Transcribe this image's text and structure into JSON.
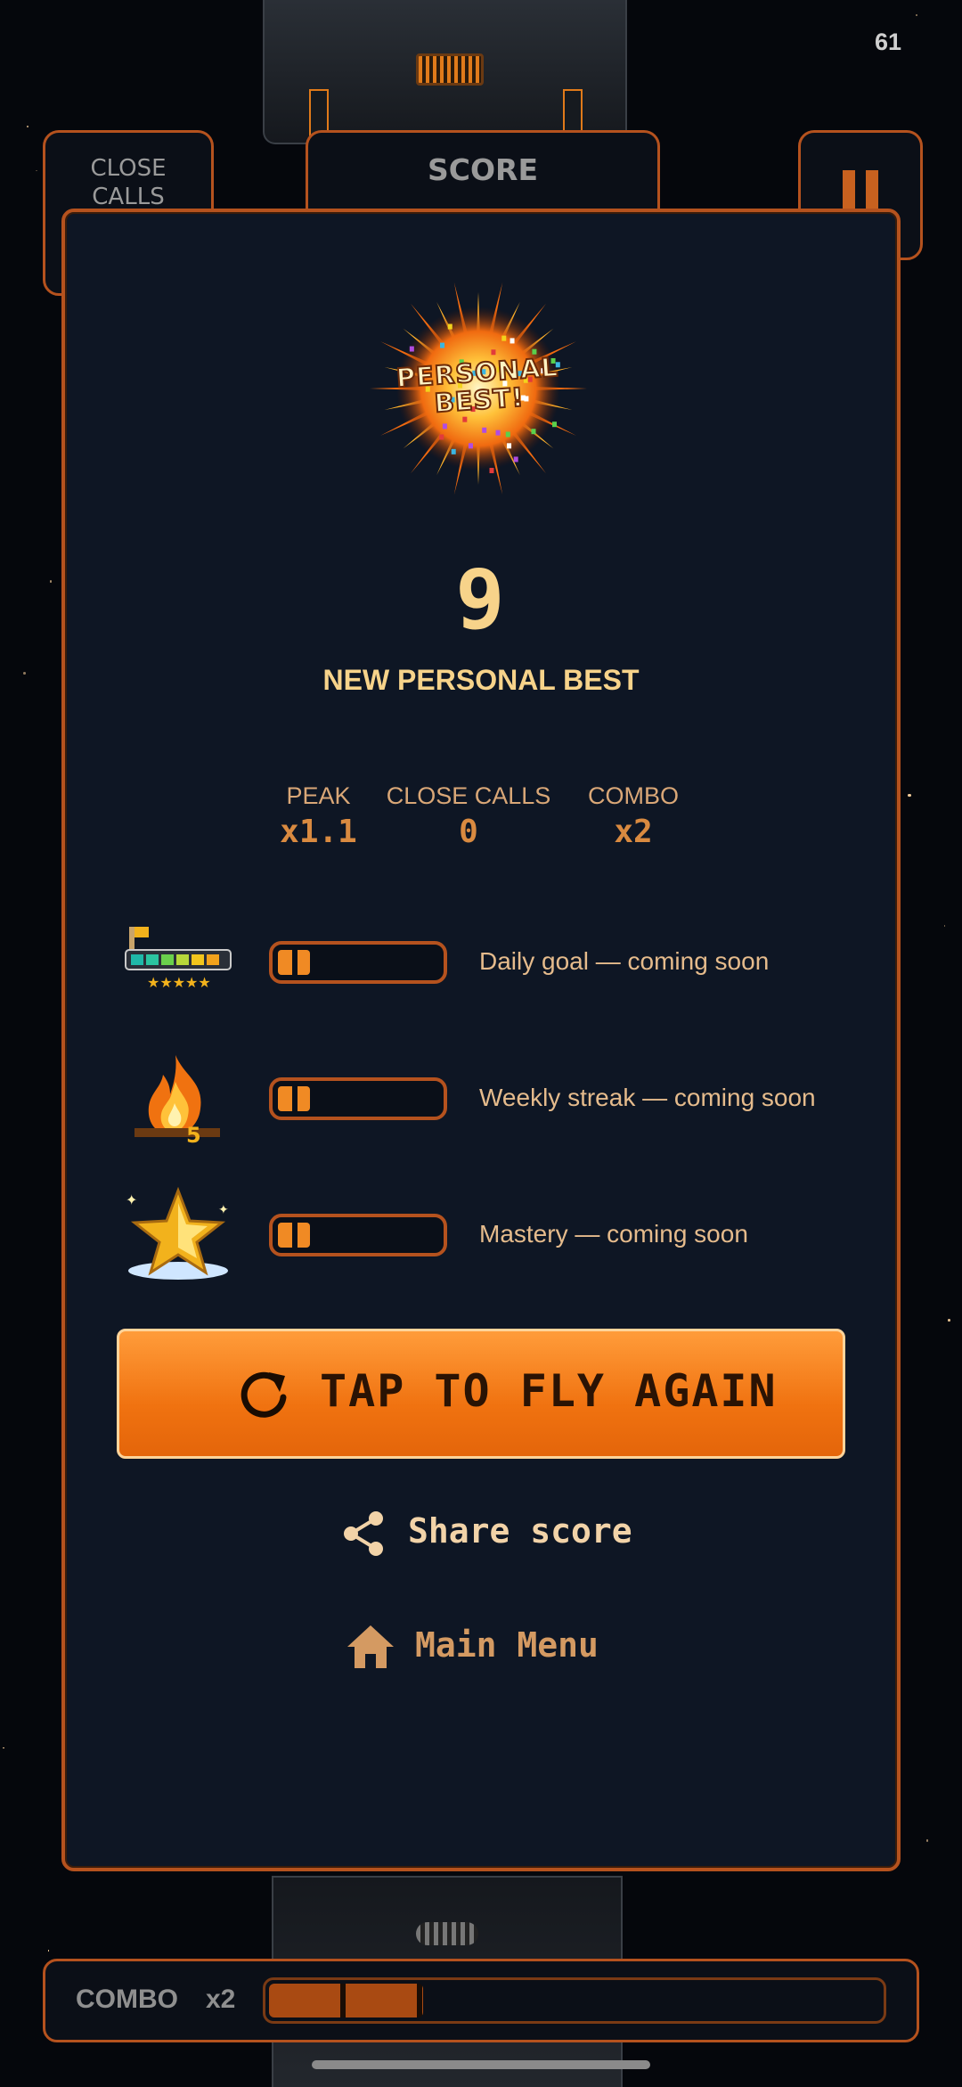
{
  "status": {
    "fps": "61"
  },
  "hud": {
    "close_calls_label": "CLOSE\nCALLS",
    "score_label": "SCORE"
  },
  "result": {
    "badge_text": "PERSONAL\nBEST!",
    "score": "9",
    "headline": "NEW PERSONAL BEST",
    "stats": [
      {
        "label": "PEAK",
        "value": "x1.1"
      },
      {
        "label": "CLOSE CALLS",
        "value": "0"
      },
      {
        "label": "COMBO",
        "value": "x2"
      }
    ]
  },
  "goals": [
    {
      "icon": "daily-goal-icon",
      "text": "Daily goal — coming soon",
      "progress": 0.2
    },
    {
      "icon": "flame-streak-icon",
      "text": "Weekly streak — coming soon",
      "progress": 0.2
    },
    {
      "icon": "star-mastery-icon",
      "text": "Mastery — coming soon",
      "progress": 0.2
    }
  ],
  "actions": {
    "fly_again": "TAP TO FLY AGAIN",
    "share": "Share score",
    "main_menu": "Main Menu"
  },
  "combo": {
    "label": "COMBO",
    "multiplier": "x2",
    "progress": 0.25
  },
  "colors": {
    "accent": "#f07210",
    "border": "#b5521e",
    "gold_text": "#f7d38a",
    "panel": "#0e1624"
  }
}
